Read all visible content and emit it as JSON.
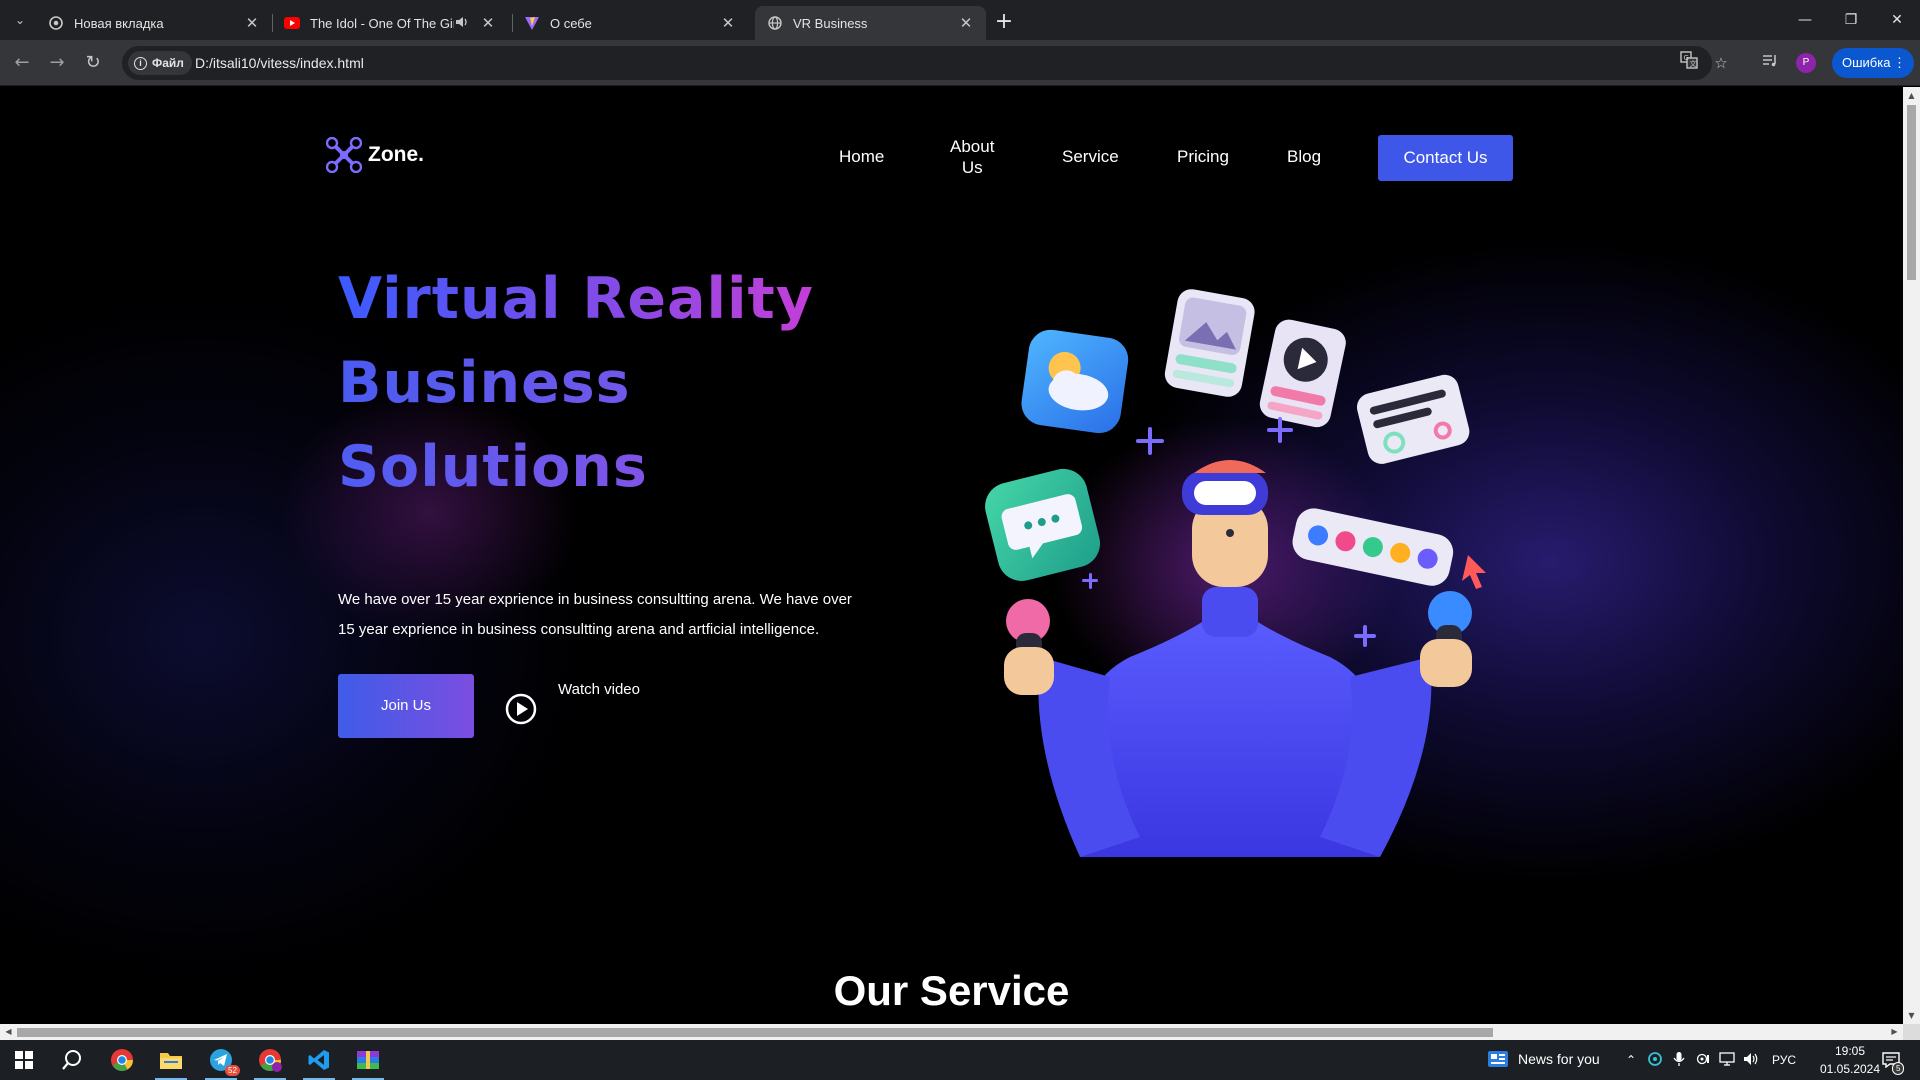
{
  "browser": {
    "tabs": [
      {
        "title": "Новая вкладка",
        "icon": "chrome-icon"
      },
      {
        "title": "The Idol - One Of The Girls",
        "icon": "youtube-icon",
        "audio": true
      },
      {
        "title": "О себе",
        "icon": "vite-icon"
      },
      {
        "title": "VR Business",
        "icon": "globe-icon",
        "active": true
      }
    ],
    "address": {
      "chip_label": "Файл",
      "url": "D:/itsali10/vitess/index.html"
    },
    "profile_initial": "P",
    "error_label": "Ошибка"
  },
  "page": {
    "logo_text": "Zone.",
    "nav": {
      "home": "Home",
      "about_line1": "About",
      "about_line2": "Us",
      "service": "Service",
      "pricing": "Pricing",
      "blog": "Blog",
      "contact": "Contact Us"
    },
    "hero": {
      "title_line1": "Virtual Reality",
      "title_line2": "Business",
      "title_line3": "Solutions",
      "desc_line1": "We have over 15 year exprience in business consultting arena. We have over",
      "desc_line2": "15 year exprience in business consultting arena and artficial intelligence.",
      "join_label": "Join Us",
      "watch_label": "Watch video"
    },
    "service_heading": "Our Service"
  },
  "colors": {
    "accent": "#3f57e8",
    "gradient_end": "#c53ed8",
    "page_bg": "#000000"
  },
  "taskbar": {
    "news_label": "News for you",
    "lang": "РУС",
    "time": "19:05",
    "date": "01.05.2024",
    "telegram_badge": "52",
    "notif_badge": "5"
  }
}
